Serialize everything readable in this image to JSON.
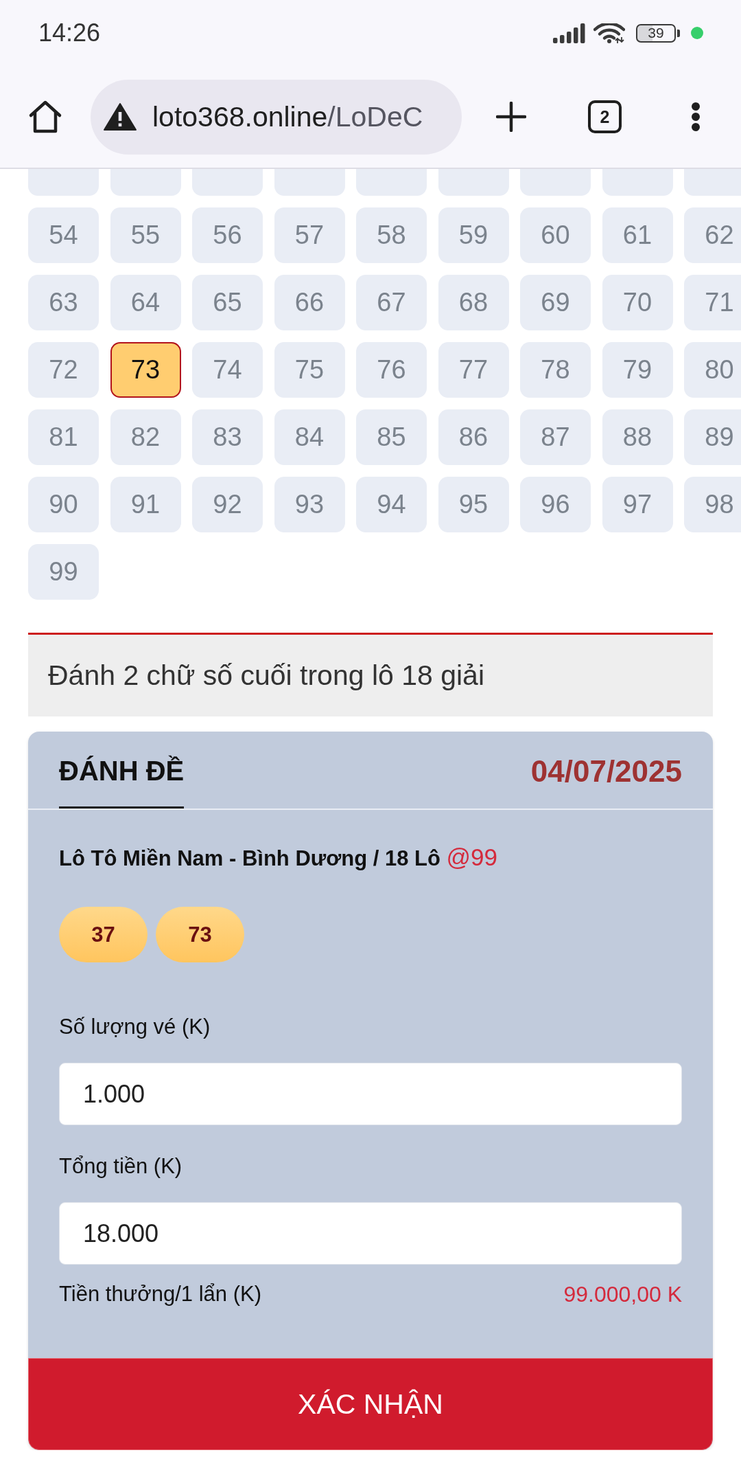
{
  "status_bar": {
    "time": "14:26",
    "battery": "39"
  },
  "browser": {
    "url_host": "loto368.online",
    "url_path": "/LoDeC",
    "tab_count": "2"
  },
  "number_grid": {
    "hidden_row": [
      {
        "selected": false
      },
      {
        "selected": false
      },
      {
        "selected": false
      },
      {
        "selected": false
      },
      {
        "selected": false
      },
      {
        "selected": false
      },
      {
        "selected": false
      },
      {
        "selected": false
      },
      {
        "selected": false
      }
    ],
    "tiles": [
      {
        "label": "54",
        "selected": false
      },
      {
        "label": "55",
        "selected": false
      },
      {
        "label": "56",
        "selected": false
      },
      {
        "label": "57",
        "selected": false
      },
      {
        "label": "58",
        "selected": false
      },
      {
        "label": "59",
        "selected": false
      },
      {
        "label": "60",
        "selected": false
      },
      {
        "label": "61",
        "selected": false
      },
      {
        "label": "62",
        "selected": false
      },
      {
        "label": "63",
        "selected": false
      },
      {
        "label": "64",
        "selected": false
      },
      {
        "label": "65",
        "selected": false
      },
      {
        "label": "66",
        "selected": false
      },
      {
        "label": "67",
        "selected": false
      },
      {
        "label": "68",
        "selected": false
      },
      {
        "label": "69",
        "selected": false
      },
      {
        "label": "70",
        "selected": false
      },
      {
        "label": "71",
        "selected": false
      },
      {
        "label": "72",
        "selected": false
      },
      {
        "label": "73",
        "selected": true
      },
      {
        "label": "74",
        "selected": false
      },
      {
        "label": "75",
        "selected": false
      },
      {
        "label": "76",
        "selected": false
      },
      {
        "label": "77",
        "selected": false
      },
      {
        "label": "78",
        "selected": false
      },
      {
        "label": "79",
        "selected": false
      },
      {
        "label": "80",
        "selected": false
      },
      {
        "label": "81",
        "selected": false
      },
      {
        "label": "82",
        "selected": false
      },
      {
        "label": "83",
        "selected": false
      },
      {
        "label": "84",
        "selected": false
      },
      {
        "label": "85",
        "selected": false
      },
      {
        "label": "86",
        "selected": false
      },
      {
        "label": "87",
        "selected": false
      },
      {
        "label": "88",
        "selected": false
      },
      {
        "label": "89",
        "selected": false
      },
      {
        "label": "90",
        "selected": false
      },
      {
        "label": "91",
        "selected": false
      },
      {
        "label": "92",
        "selected": false
      },
      {
        "label": "93",
        "selected": false
      },
      {
        "label": "94",
        "selected": false
      },
      {
        "label": "95",
        "selected": false
      },
      {
        "label": "96",
        "selected": false
      },
      {
        "label": "97",
        "selected": false
      },
      {
        "label": "98",
        "selected": false
      },
      {
        "label": "99",
        "selected": false
      }
    ]
  },
  "info_banner": {
    "text": "Đánh 2 chữ số cuối trong lô 18 giải"
  },
  "bet_form": {
    "tabs": [
      {
        "label": "ĐÁNH ĐỀ",
        "selected": true
      }
    ],
    "date": "04/07/2025",
    "game": "Lô Tô Miền Nam - Bình Dương / 18 Lô",
    "odds": "@99",
    "picked_numbers": [
      "37",
      "73"
    ],
    "fields": [
      {
        "label": "Số lượng vé (K)",
        "value": "1.000"
      },
      {
        "label": "Tổng tiền (K)",
        "value": "18.000"
      }
    ],
    "payout": {
      "label": "Tiền thưởng/1 lẩn (K)",
      "value": "99.000,00 K"
    },
    "confirm_button": "XÁC NHẬN"
  }
}
